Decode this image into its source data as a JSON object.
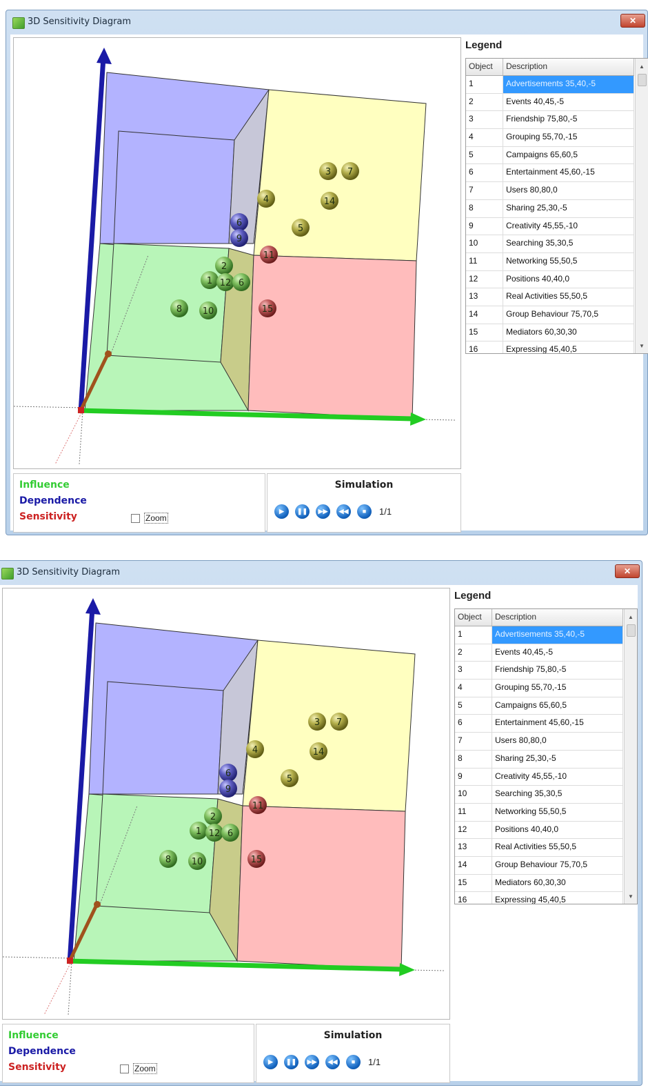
{
  "window": {
    "title": "3D Sensitivity Diagram",
    "close_glyph": "✕"
  },
  "legend": {
    "title": "Legend",
    "columns": [
      "Object",
      "Description"
    ],
    "selected_row": 0,
    "rows": [
      {
        "object": "1",
        "description": "Advertisements 35,40,-5"
      },
      {
        "object": "2",
        "description": "Events 40,45,-5"
      },
      {
        "object": "3",
        "description": "Friendship 75,80,-5"
      },
      {
        "object": "4",
        "description": "Grouping 55,70,-15"
      },
      {
        "object": "5",
        "description": "Campaigns 65,60,5"
      },
      {
        "object": "6",
        "description": "Entertainment 45,60,-15"
      },
      {
        "object": "7",
        "description": "Users 80,80,0"
      },
      {
        "object": "8",
        "description": "Sharing 25,30,-5"
      },
      {
        "object": "9",
        "description": "Creativity 45,55,-10"
      },
      {
        "object": "10",
        "description": "Searching 35,30,5"
      },
      {
        "object": "11",
        "description": "Networking 55,50,5"
      },
      {
        "object": "12",
        "description": "Positions 40,40,0"
      },
      {
        "object": "13",
        "description": "Real Activities 55,50,5"
      },
      {
        "object": "14",
        "description": "Group Behaviour 75,70,5"
      },
      {
        "object": "15",
        "description": "Mediators 60,30,30"
      },
      {
        "object": "16",
        "description": "Expressing 45,40,5"
      }
    ]
  },
  "axes": {
    "influence": "Influence",
    "dependence": "Dependence",
    "sensitivity": "Sensitivity",
    "influence_color": "#33cc33",
    "dependence_color": "#1a1aa6",
    "sensitivity_color": "#cc2222"
  },
  "zoom_label": "Zoom",
  "zoom_checked": false,
  "simulation": {
    "title": "Simulation",
    "buttons": [
      "play-icon",
      "pause-icon",
      "fast-forward-icon",
      "rewind-icon",
      "stop-icon"
    ],
    "page": "1/1"
  },
  "quadrant_colors": {
    "top_left": "#b3b3ff",
    "top_right": "#ffffc0",
    "bottom_left": "#b8f5b8",
    "bottom_right": "#ffbcbc"
  },
  "spheres": [
    {
      "label": "1",
      "color": "green"
    },
    {
      "label": "2",
      "color": "green"
    },
    {
      "label": "3",
      "color": "olive"
    },
    {
      "label": "4",
      "color": "olive"
    },
    {
      "label": "5",
      "color": "olive"
    },
    {
      "label": "6",
      "color": "blue"
    },
    {
      "label": "7",
      "color": "olive"
    },
    {
      "label": "8",
      "color": "green"
    },
    {
      "label": "9",
      "color": "blue"
    },
    {
      "label": "10",
      "color": "green"
    },
    {
      "label": "11",
      "color": "red"
    },
    {
      "label": "12",
      "color": "green"
    },
    {
      "label": "6",
      "color": "green"
    },
    {
      "label": "14",
      "color": "olive"
    },
    {
      "label": "15",
      "color": "red"
    }
  ]
}
